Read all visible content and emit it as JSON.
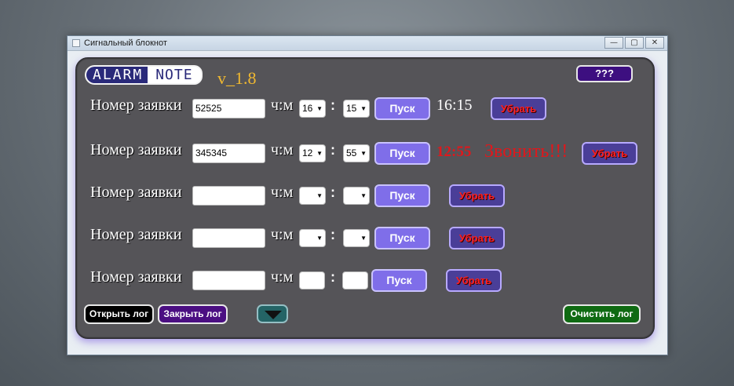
{
  "window": {
    "title": "Сигнальный блокнот",
    "buttons": [
      "—",
      "▢",
      "✕"
    ]
  },
  "header": {
    "logo_left": "ALARM",
    "logo_right": "NOTE",
    "version": "v_1.8",
    "help_label": "???"
  },
  "rows": [
    {
      "label": "Номер заявки",
      "ticket": "52525",
      "hm_label": "ч:м",
      "hour": "16",
      "minute": "15",
      "start_label": "Пуск",
      "time": "16:15",
      "alarm": "",
      "remove_label": "Убрать"
    },
    {
      "label": "Номер заявки",
      "ticket": "345345",
      "hm_label": "ч:м",
      "hour": "12",
      "minute": "55",
      "start_label": "Пуск",
      "time": "12:55",
      "alarm": "Звонить!!!",
      "remove_label": "Убрать"
    },
    {
      "label": "Номер заявки",
      "ticket": "",
      "hm_label": "ч:м",
      "hour": "",
      "minute": "",
      "start_label": "Пуск",
      "time": "",
      "alarm": "",
      "remove_label": "Убрать"
    },
    {
      "label": "Номер заявки",
      "ticket": "",
      "hm_label": "ч:м",
      "hour": "",
      "minute": "",
      "start_label": "Пуск",
      "time": "",
      "alarm": "",
      "remove_label": "Убрать"
    },
    {
      "label": "Номер заявки",
      "ticket": "",
      "hm_label": "ч:м",
      "hour": "",
      "minute": "",
      "start_label": "Пуск",
      "time": "",
      "alarm": "",
      "remove_label": "Убрать"
    }
  ],
  "footer": {
    "open_log": "Открыть лог",
    "close_log": "Закрыть лог",
    "clear_log": "Очистить лог"
  },
  "colors": {
    "panel": "#555458",
    "start_button": "#7f6ee9",
    "remove_text": "#ff1f1f",
    "alarm_text": "#e0171b",
    "version_text": "#f0b830"
  }
}
